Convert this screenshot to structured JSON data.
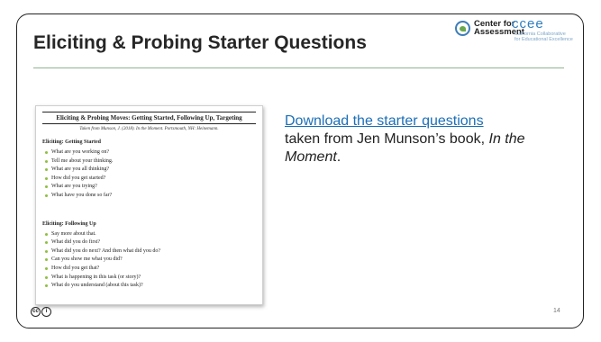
{
  "slide": {
    "title": "Eliciting & Probing Starter Questions",
    "page_number": "14"
  },
  "logos": {
    "cfa_line1": "Center for",
    "cfa_line2": "Assessment",
    "ccee_big": "ccee",
    "ccee_line1": "California Collaborative",
    "ccee_line2": "for Educational Excellence"
  },
  "document": {
    "title": "Eliciting & Probing Moves: Getting Started, Following Up, Targeting",
    "source": "Taken from Munson, J. (2018). In the Moment. Portsmouth, NH: Heinemann.",
    "section1": {
      "heading": "Eliciting: Getting Started",
      "items": [
        "What are you working on?",
        "Tell me about your thinking.",
        "What are you all thinking?",
        "How did you get started?",
        "What are you trying?",
        "What have you done so far?"
      ]
    },
    "section2": {
      "heading": "Eliciting: Following Up",
      "items": [
        "Say more about that.",
        "What did you do first?",
        "What did you do next? And then what did you do?",
        "Can you show me what you did?",
        "How did you get that?",
        "What is happening in this task (or story)?",
        "What do you understand (about this task)?"
      ]
    }
  },
  "body": {
    "link": "Download the starter questions",
    "text1": "taken from Jen Munson’s book,",
    "italic": "In the Moment",
    "text2": "."
  },
  "license": {
    "cc": "cc",
    "by": "i"
  }
}
